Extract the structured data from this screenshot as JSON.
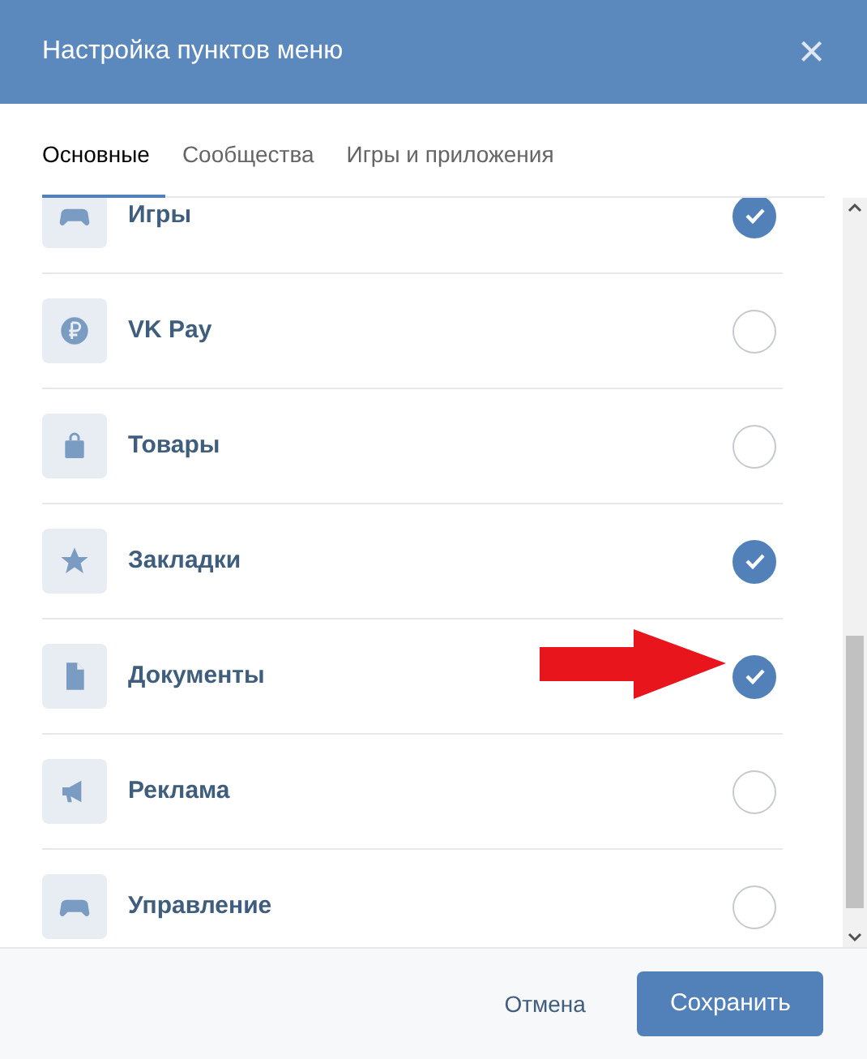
{
  "window": {
    "title": "Настройка пунктов меню",
    "close": "×"
  },
  "tabs": [
    {
      "label": "Основные",
      "selected": true
    },
    {
      "label": "Сообщества",
      "selected": false
    },
    {
      "label": "Игры и приложения",
      "selected": false
    }
  ],
  "items": [
    {
      "label": "Игры",
      "checked": true
    },
    {
      "label": "VK Pay",
      "checked": false
    },
    {
      "label": "Товары",
      "checked": false
    },
    {
      "label": "Закладки",
      "checked": true
    },
    {
      "label": "Документы",
      "checked": true
    },
    {
      "label": "Реклама",
      "checked": false
    },
    {
      "label": "Управление",
      "checked": false
    }
  ],
  "buttons": [
    {
      "label": "Отмена",
      "kind": "secondary"
    },
    {
      "label": "Сохранить",
      "kind": "primary"
    }
  ]
}
